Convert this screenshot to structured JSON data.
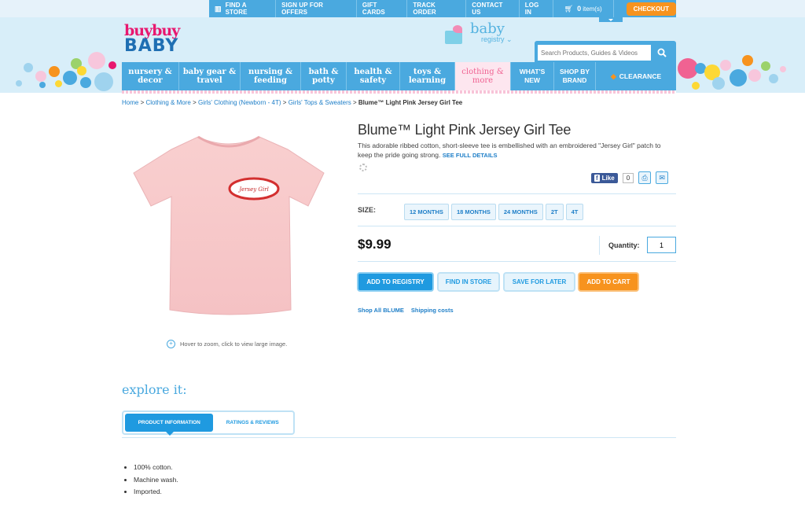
{
  "topbar": {
    "find_store": "FIND A STORE",
    "signup": "SIGN UP FOR OFFERS",
    "gift_cards": "GIFT CARDS",
    "track_order": "TRACK ORDER",
    "contact": "CONTACT US",
    "login": "LOG IN",
    "cart_count": "0",
    "cart_label": "item(s)",
    "checkout": "CHECKOUT"
  },
  "logo": {
    "line1": "buybuy",
    "line2": "BABY"
  },
  "registry": {
    "line1": "baby",
    "line2": "registry"
  },
  "search": {
    "placeholder": "Search Products, Guides & Videos"
  },
  "nav": {
    "items": [
      {
        "line1": "nursery &",
        "line2": "decor"
      },
      {
        "line1": "baby gear &",
        "line2": "travel"
      },
      {
        "line1": "nursing &",
        "line2": "feeding"
      },
      {
        "line1": "bath &",
        "line2": "potty"
      },
      {
        "line1": "health &",
        "line2": "safety"
      },
      {
        "line1": "toys &",
        "line2": "learning"
      },
      {
        "line1": "clothing &",
        "line2": "more"
      },
      {
        "line1": "WHAT'S",
        "line2": "NEW"
      },
      {
        "line1": "SHOP BY",
        "line2": "BRAND"
      }
    ],
    "clearance": "CLEARANCE"
  },
  "breadcrumb": {
    "items": [
      "Home",
      "Clothing & More",
      "Girls' Clothing (Newborn - 4T)",
      "Girls' Tops & Sweaters"
    ],
    "current": "Blume™ Light Pink Jersey Girl Tee"
  },
  "product": {
    "title": "Blume™ Light Pink Jersey Girl Tee",
    "description": "This adorable ribbed cotton, short-sleeve tee is embellished with an embroidered \"Jersey Girl\" patch to keep the pride going strong.",
    "see_full": "SEE FULL DETAILS",
    "patch_text": "Jersey Girl",
    "zoom_hint": "Hover to zoom, click to view large image.",
    "fb_like": "Like",
    "fb_count": "0",
    "size_label": "SIZE:",
    "sizes": [
      "12 MONTHS",
      "18 MONTHS",
      "24 MONTHS",
      "2T",
      "4T"
    ],
    "price": "$9.99",
    "qty_label": "Quantity:",
    "qty_value": "1",
    "buttons": {
      "registry": "ADD TO REGISTRY",
      "find_store": "FIND IN STORE",
      "save_later": "SAVE FOR LATER",
      "add_cart": "ADD TO CART"
    },
    "shop_all": "Shop All BLUME",
    "shipping": "Shipping costs"
  },
  "explore": {
    "title": "explore it:",
    "tabs": [
      "PRODUCT INFORMATION",
      "RATINGS & REVIEWS"
    ],
    "bullets": [
      "100% cotton.",
      "Machine wash.",
      "Imported."
    ]
  },
  "colors": {
    "accent": "#4aa9df",
    "orange": "#f7931e",
    "pink": "#e8186f"
  }
}
